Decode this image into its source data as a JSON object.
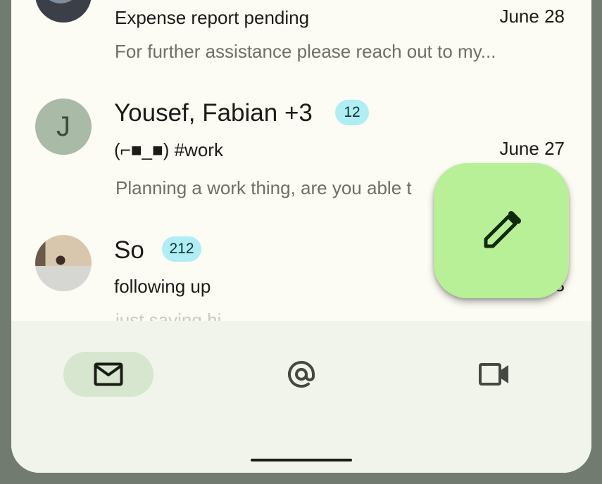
{
  "emails": [
    {
      "subject": "Expense report pending",
      "date": "June 28",
      "preview": "For further assistance please reach out to my..."
    },
    {
      "avatar_letter": "J",
      "sender": "Yousef, Fabian +3",
      "count": "12",
      "subject": "(⌐■_■) #work",
      "date": "June 27",
      "preview": "Planning a work thing, are you able t"
    },
    {
      "sender": "So",
      "count": "212",
      "subject": "following up",
      "date_visible": "3",
      "preview": "just saying hi"
    }
  ],
  "fab": {
    "icon": "pencil-icon",
    "color": "#b7f097"
  },
  "nav": {
    "items": [
      {
        "icon": "mail-icon",
        "active": true
      },
      {
        "icon": "at-sign-icon",
        "active": false
      },
      {
        "icon": "video-camera-icon",
        "active": false
      }
    ]
  },
  "colors": {
    "badge": "#aeeef4",
    "active_nav": "#d7e6cf",
    "surface": "#fcfbf4",
    "frame": "#727b70"
  }
}
